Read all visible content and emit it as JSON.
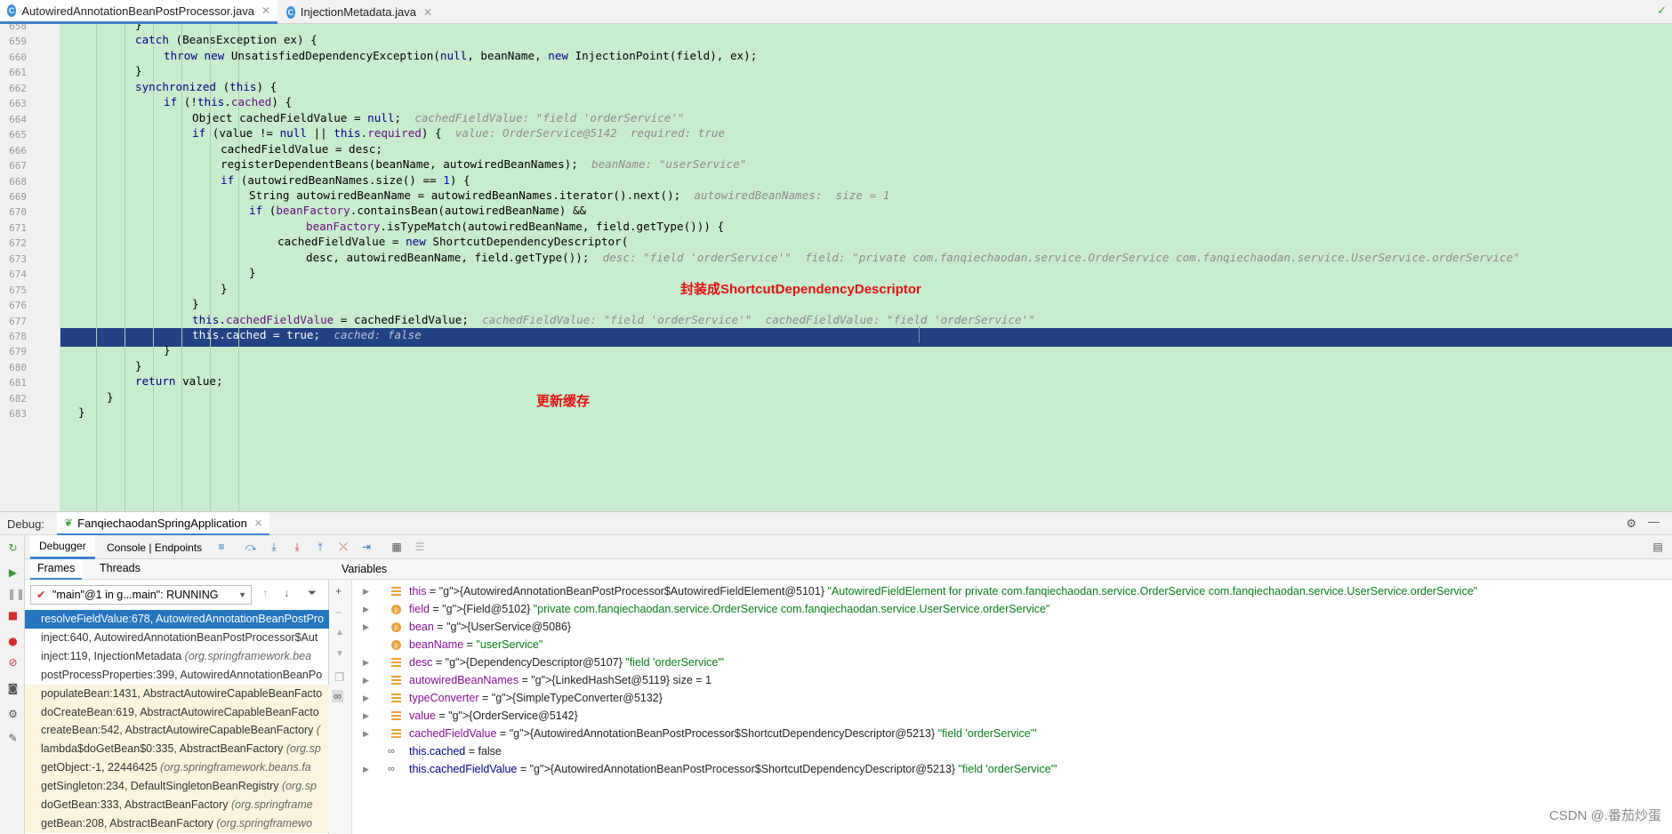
{
  "tabs": [
    {
      "label": "AutowiredAnnotationBeanPostProcessor.java",
      "active": true
    },
    {
      "label": "InjectionMetadata.java",
      "active": false
    }
  ],
  "editor": {
    "lines": [
      {
        "n": "658",
        "code": "}"
      },
      {
        "n": "659",
        "code": "catch (BeansException ex) {"
      },
      {
        "n": "660",
        "code": "throw new UnsatisfiedDependencyException(null, beanName, new InjectionPoint(field), ex);"
      },
      {
        "n": "661",
        "code": "}"
      },
      {
        "n": "662",
        "code": "synchronized (this) {"
      },
      {
        "n": "663",
        "code": "if (!this.cached) {"
      },
      {
        "n": "664",
        "code": "Object cachedFieldValue = null;",
        "hint": "cachedFieldValue: \"field 'orderService'\""
      },
      {
        "n": "665",
        "code": "if (value != null || this.required) {",
        "hint": "value: OrderService@5142  required: true"
      },
      {
        "n": "666",
        "code": "cachedFieldValue = desc;"
      },
      {
        "n": "667",
        "code": "registerDependentBeans(beanName, autowiredBeanNames);",
        "hint": "beanName: \"userService\""
      },
      {
        "n": "668",
        "code": "if (autowiredBeanNames.size() == 1) {"
      },
      {
        "n": "669",
        "code": "String autowiredBeanName = autowiredBeanNames.iterator().next();",
        "hint": "autowiredBeanNames:  size = 1"
      },
      {
        "n": "670",
        "code": "if (beanFactory.containsBean(autowiredBeanName) &&"
      },
      {
        "n": "671",
        "code": "beanFactory.isTypeMatch(autowiredBeanName, field.getType())) {"
      },
      {
        "n": "672",
        "code": "cachedFieldValue = new ShortcutDependencyDescriptor("
      },
      {
        "n": "673",
        "code": "desc, autowiredBeanName, field.getType());",
        "hint": "desc: \"field 'orderService'\"  field: \"private com.fanqiechaodan.service.OrderService com.fanqiechaodan.service.UserService.orderService\""
      },
      {
        "n": "674",
        "code": "}"
      },
      {
        "n": "675",
        "code": "}"
      },
      {
        "n": "676",
        "code": "}"
      },
      {
        "n": "677",
        "code": "this.cachedFieldValue = cachedFieldValue;",
        "hint": "cachedFieldValue: \"field 'orderService'\"  cachedFieldValue: \"field 'orderService'\""
      },
      {
        "n": "678",
        "code": "this.cached = true;",
        "hint": "cached: false"
      },
      {
        "n": "679",
        "code": "}"
      },
      {
        "n": "680",
        "code": "}"
      },
      {
        "n": "681",
        "code": "return value;"
      },
      {
        "n": "682",
        "code": "}"
      },
      {
        "n": "683",
        "code": "}"
      }
    ],
    "annotations": {
      "wrap": "封装成ShortcutDependencyDescriptor",
      "cache": "更新缓存"
    }
  },
  "debug": {
    "label": "Debug:",
    "session": "FanqiechaodanSpringApplication",
    "tab_debugger": "Debugger",
    "tab_console": "Console | Endpoints"
  },
  "frames": {
    "tab_frames": "Frames",
    "tab_threads": "Threads",
    "thread": "\"main\"@1 in g...main\": RUNNING",
    "items": [
      {
        "method": "resolveFieldValue:678, AutowiredAnnotationBeanPostPro",
        "pkg": ""
      },
      {
        "method": "inject:640, AutowiredAnnotationBeanPostProcessor$Aut",
        "pkg": ""
      },
      {
        "method": "inject:119, InjectionMetadata",
        "pkg": "(org.springframework.bea"
      },
      {
        "method": "postProcessProperties:399, AutowiredAnnotationBeanPo",
        "pkg": ""
      },
      {
        "method": "populateBean:1431, AbstractAutowireCapableBeanFacto",
        "pkg": ""
      },
      {
        "method": "doCreateBean:619, AbstractAutowireCapableBeanFacto",
        "pkg": ""
      },
      {
        "method": "createBean:542, AbstractAutowireCapableBeanFactory",
        "pkg": "("
      },
      {
        "method": "lambda$doGetBean$0:335, AbstractBeanFactory",
        "pkg": "(org.sp"
      },
      {
        "method": "getObject:-1, 22446425",
        "pkg": "(org.springframework.beans.fa"
      },
      {
        "method": "getSingleton:234, DefaultSingletonBeanRegistry",
        "pkg": "(org.sp"
      },
      {
        "method": "doGetBean:333, AbstractBeanFactory",
        "pkg": "(org.springframe"
      },
      {
        "method": "getBean:208, AbstractBeanFactory",
        "pkg": "(org.springframewo"
      }
    ]
  },
  "variables": {
    "header": "Variables",
    "items": [
      {
        "name": "this",
        "rest": " = {AutowiredAnnotationBeanPostProcessor$AutowiredFieldElement@5101} \"AutowiredFieldElement for private com.fanqiechaodan.service.OrderService com.fanqiechaodan.service.UserService.orderService\"",
        "icon": "field"
      },
      {
        "name": "field",
        "rest": " = {Field@5102} \"private com.fanqiechaodan.service.OrderService com.fanqiechaodan.service.UserService.orderService\"",
        "icon": "param"
      },
      {
        "name": "bean",
        "rest": " = {UserService@5086}",
        "icon": "param"
      },
      {
        "name": "beanName",
        "rest": " = \"userService\"",
        "icon": "param"
      },
      {
        "name": "desc",
        "rest": " = {DependencyDescriptor@5107} \"field 'orderService'\"",
        "icon": "field"
      },
      {
        "name": "autowiredBeanNames",
        "rest": " = {LinkedHashSet@5119}  size = 1",
        "icon": "field"
      },
      {
        "name": "typeConverter",
        "rest": " = {SimpleTypeConverter@5132}",
        "icon": "field"
      },
      {
        "name": "value",
        "rest": " = {OrderService@5142}",
        "icon": "field"
      },
      {
        "name": "cachedFieldValue",
        "rest": " = {AutowiredAnnotationBeanPostProcessor$ShortcutDependencyDescriptor@5213} \"field 'orderService'\"",
        "icon": "field"
      },
      {
        "name": "this.cached",
        "rest": " = false",
        "icon": "watch"
      },
      {
        "name": "this.cachedFieldValue",
        "rest": " = {AutowiredAnnotationBeanPostProcessor$ShortcutDependencyDescriptor@5213} \"field 'orderService'\"",
        "icon": "watch"
      }
    ]
  },
  "watermark": "CSDN @.番茄炒蛋"
}
